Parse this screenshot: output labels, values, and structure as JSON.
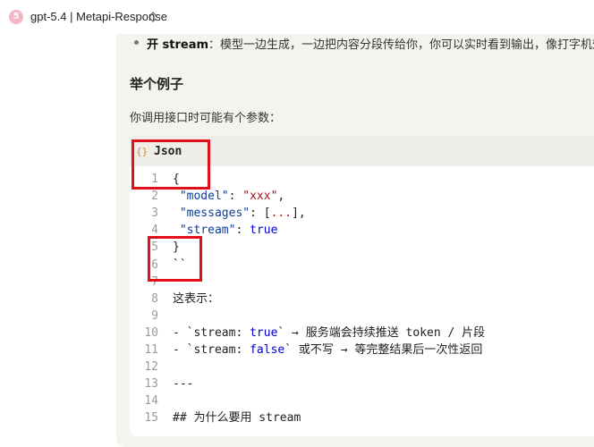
{
  "topbar": {
    "badge": "5",
    "title": "gpt-5.4 | Metapi-Response"
  },
  "message": {
    "bullet": {
      "bold": "开 stream",
      "rest": "：模型一边生成，一边把内容分段传给你，你可以实时看到输出，像打字机效"
    },
    "heading": "举个例子",
    "intro": "你调用接口时可能有个参数："
  },
  "code_block": {
    "language": "Json",
    "lang_icon": "{}",
    "lines": [
      {
        "n": "1",
        "text": "{"
      },
      {
        "n": "2",
        "text": " \"model\": \"xxx\","
      },
      {
        "n": "3",
        "text": " \"messages\": [...],"
      },
      {
        "n": "4",
        "text": " \"stream\": true"
      },
      {
        "n": "5",
        "text": "}"
      },
      {
        "n": "6",
        "text": "``"
      },
      {
        "n": "7",
        "text": ""
      },
      {
        "n": "8",
        "text": "这表示："
      },
      {
        "n": "9",
        "text": ""
      },
      {
        "n": "10",
        "text": "- `stream: true` → 服务端会持续推送 token / 片段"
      },
      {
        "n": "11",
        "text": "- `stream: false` 或不写 → 等完整结果后一次性返回"
      },
      {
        "n": "12",
        "text": ""
      },
      {
        "n": "13",
        "text": "---"
      },
      {
        "n": "14",
        "text": ""
      },
      {
        "n": "15",
        "text": "## 为什么要用 stream"
      }
    ]
  },
  "colors": {
    "annotation": "#e0101a",
    "panel_bg": "#f5f3ee",
    "code_bg": "#ffffff",
    "key": "#0b3c9e",
    "string": "#a31515",
    "boolean": "#0000c8"
  }
}
